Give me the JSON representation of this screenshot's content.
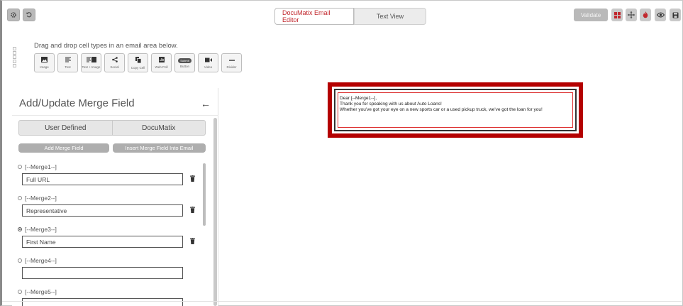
{
  "header": {
    "tabs": [
      {
        "label": "DocuMatix Email Editor",
        "active": true
      },
      {
        "label": "Text View",
        "active": false
      }
    ],
    "validate_label": "Validate",
    "left_icons": [
      "gear-icon",
      "history-icon"
    ],
    "right_icons": [
      "grid-icon",
      "move-icon",
      "fire-icon",
      "eye-icon",
      "save-icon"
    ]
  },
  "toolbox": {
    "instruction": "Drag and drop cell types in an email area below.",
    "tools": [
      {
        "icon": "image-icon",
        "label": "Image"
      },
      {
        "icon": "text-icon",
        "label": "Text"
      },
      {
        "icon": "text-image-icon",
        "label": "Text + Image"
      },
      {
        "icon": "share-icon",
        "label": "Social"
      },
      {
        "icon": "copy-icon",
        "label": "Copy Cell"
      },
      {
        "icon": "web-poll-icon",
        "label": "Web Poll"
      },
      {
        "icon": "button-icon",
        "label": "Button",
        "pill": "Submit"
      },
      {
        "icon": "video-icon",
        "label": "Video"
      },
      {
        "icon": "divider-icon",
        "label": "Divider"
      }
    ]
  },
  "panel": {
    "title": "Add/Update Merge Field",
    "segments": [
      "User Defined",
      "DocuMatix"
    ],
    "add_button": "Add Merge Field",
    "insert_button": "Insert Merge Field Into Email",
    "fields": [
      {
        "name": "[--Merge1--]",
        "value": "Full URL",
        "selected": false
      },
      {
        "name": "[--Merge2--]",
        "value": "Representative",
        "selected": false
      },
      {
        "name": "[--Merge3--]",
        "value": "First Name",
        "selected": true
      },
      {
        "name": "[--Merge4--]",
        "value": "",
        "selected": false
      },
      {
        "name": "[--Merge5--]",
        "value": "",
        "selected": false
      }
    ]
  },
  "email": {
    "lines": [
      "Dear [--Merge1--],",
      "Thank you for speaking with us about Auto Loans!",
      "Whether you've got your eye on a new sports car or a used pickup truck, we've got the loan for you!"
    ]
  },
  "colors": {
    "accent": "#c1272d",
    "email_border": "#b40000"
  }
}
